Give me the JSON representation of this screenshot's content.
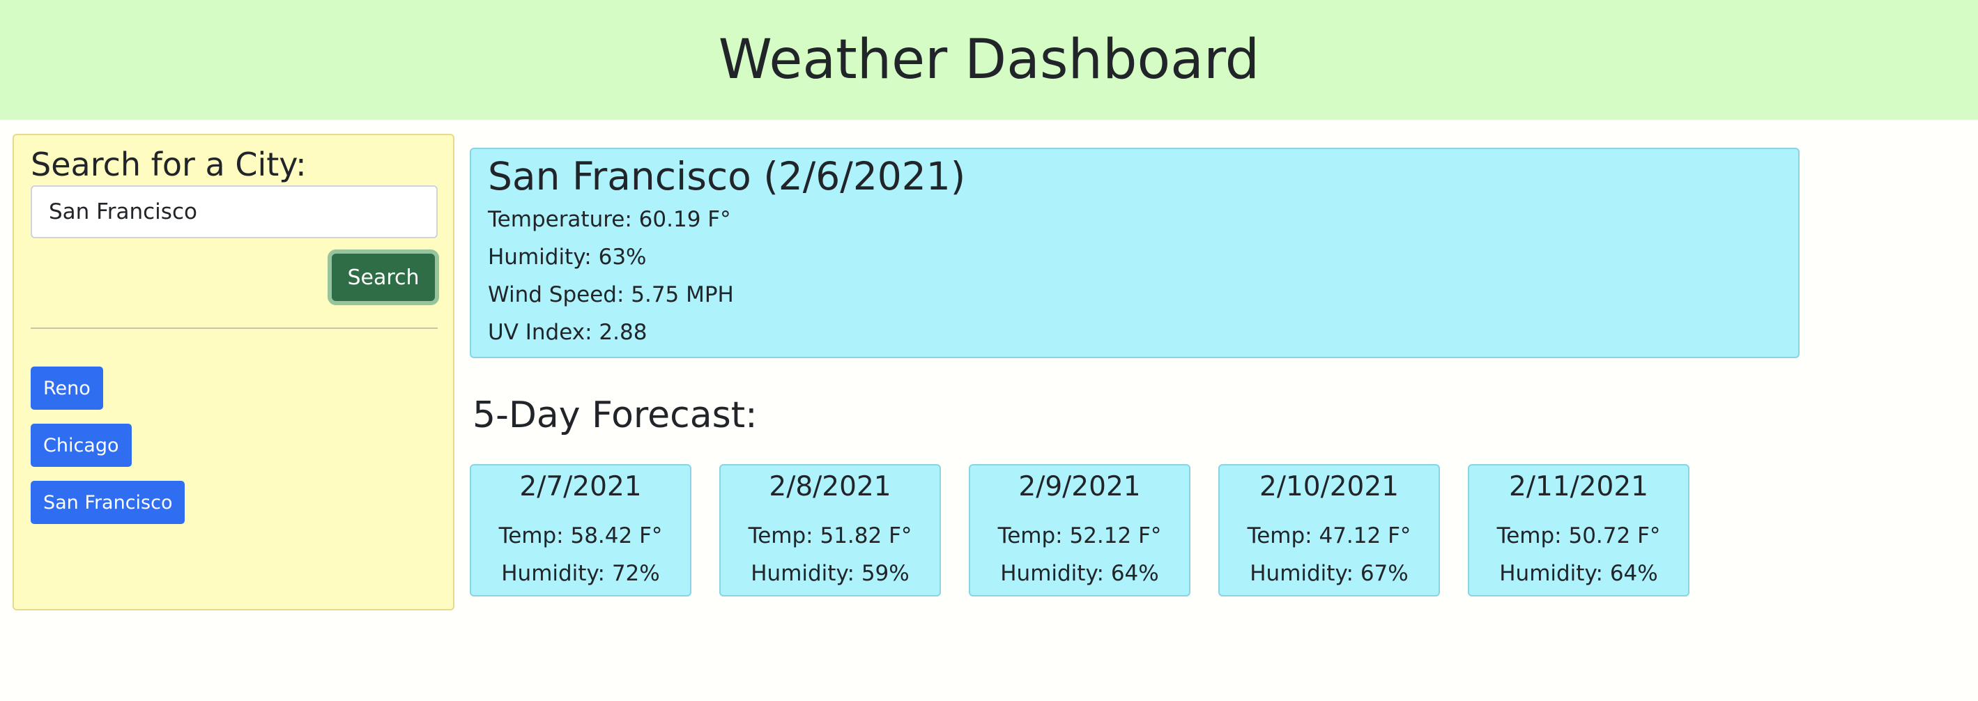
{
  "header": {
    "title": "Weather Dashboard"
  },
  "search": {
    "title": "Search for a City:",
    "input_value": "San Francisco",
    "button_label": "Search"
  },
  "history": [
    {
      "label": "Reno"
    },
    {
      "label": "Chicago"
    },
    {
      "label": "San Francisco"
    }
  ],
  "current": {
    "title": "San Francisco (2/6/2021)",
    "temperature": "Temperature: 60.19 F°",
    "humidity": "Humidity: 63%",
    "wind": "Wind Speed: 5.75 MPH",
    "uv": "UV Index: 2.88"
  },
  "forecast": {
    "title": "5-Day Forecast:",
    "days": [
      {
        "date": "2/7/2021",
        "temp": "Temp: 58.42 F°",
        "humidity": "Humidity: 72%"
      },
      {
        "date": "2/8/2021",
        "temp": "Temp: 51.82 F°",
        "humidity": "Humidity: 59%"
      },
      {
        "date": "2/9/2021",
        "temp": "Temp: 52.12 F°",
        "humidity": "Humidity: 64%"
      },
      {
        "date": "2/10/2021",
        "temp": "Temp: 47.12 F°",
        "humidity": "Humidity: 67%"
      },
      {
        "date": "2/11/2021",
        "temp": "Temp: 50.72 F°",
        "humidity": "Humidity: 64%"
      }
    ]
  },
  "colors": {
    "header_bg": "#d4fcc4",
    "panel_bg": "#fefcc0",
    "card_bg": "#aef2fb",
    "search_button": "#2f6d46",
    "history_button": "#2f6ef0"
  }
}
